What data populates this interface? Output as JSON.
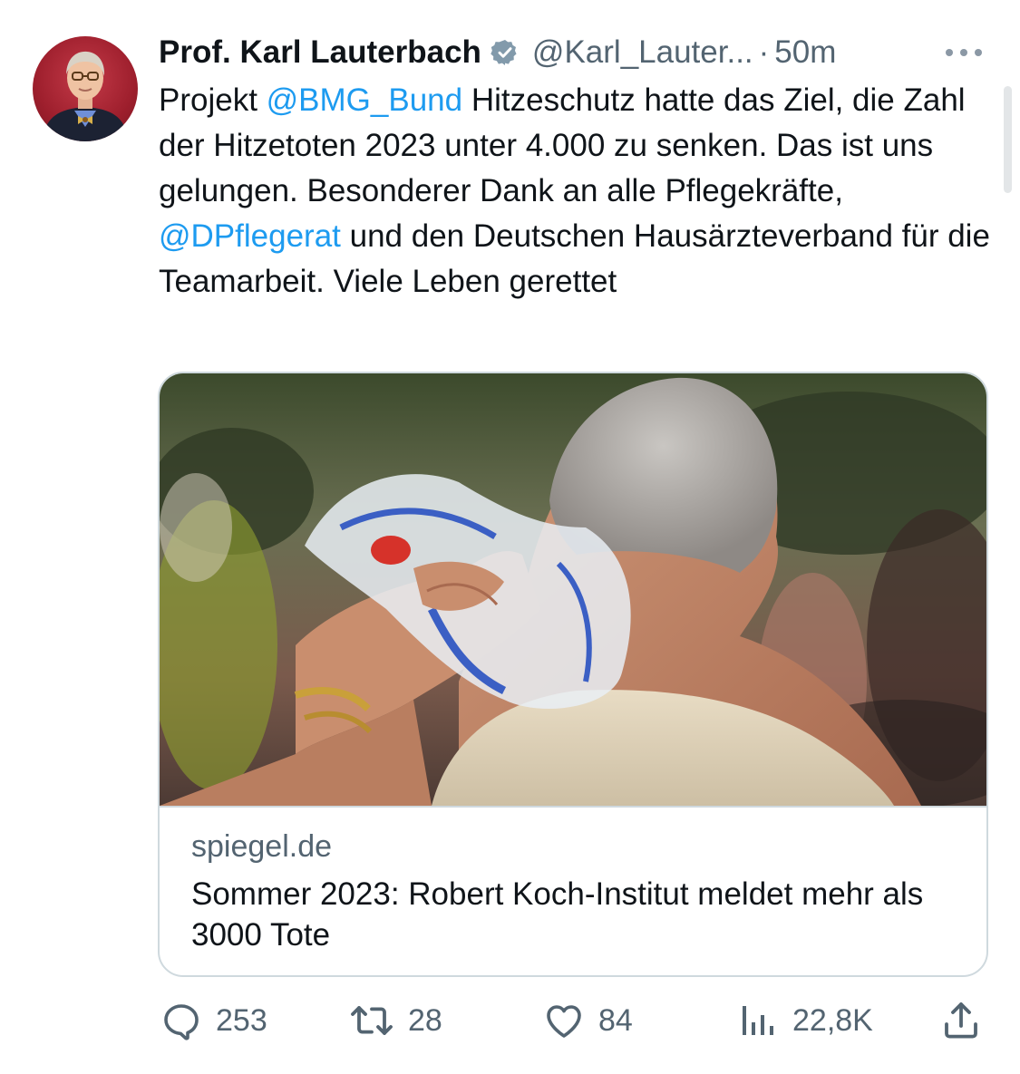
{
  "author": {
    "name": "Prof. Karl Lauterbach",
    "handle": "@Karl_Lauter...",
    "separator": "·",
    "time": "50m"
  },
  "tweet": {
    "seg1": "Projekt ",
    "mention1": "@BMG_Bund",
    "seg2": " Hitzeschutz hatte das Ziel, die Zahl der Hitzetoten 2023 unter 4.000 zu senken. Das ist uns gelungen. Besonderer Dank an alle Pflegekräfte, ",
    "mention2": "@DPflegerat",
    "seg3": " und den Deutschen Hausärzteverband für die Teamarbeit. Viele Leben gerettet"
  },
  "card": {
    "domain": "spiegel.de",
    "title": "Sommer 2023: Robert Koch-Institut meldet mehr als 3000 Tote"
  },
  "actions": {
    "replies": "253",
    "retweets": "28",
    "likes": "84",
    "views": "22,8K"
  },
  "icons": {
    "verified": "verified-badge-icon",
    "more": "more-icon",
    "reply": "reply-icon",
    "retweet": "retweet-icon",
    "like": "heart-icon",
    "views": "views-icon",
    "share": "share-icon"
  },
  "colors": {
    "text": "#0f1419",
    "secondary": "#536471",
    "link": "#1d9bf0",
    "border": "#cfd9de"
  }
}
